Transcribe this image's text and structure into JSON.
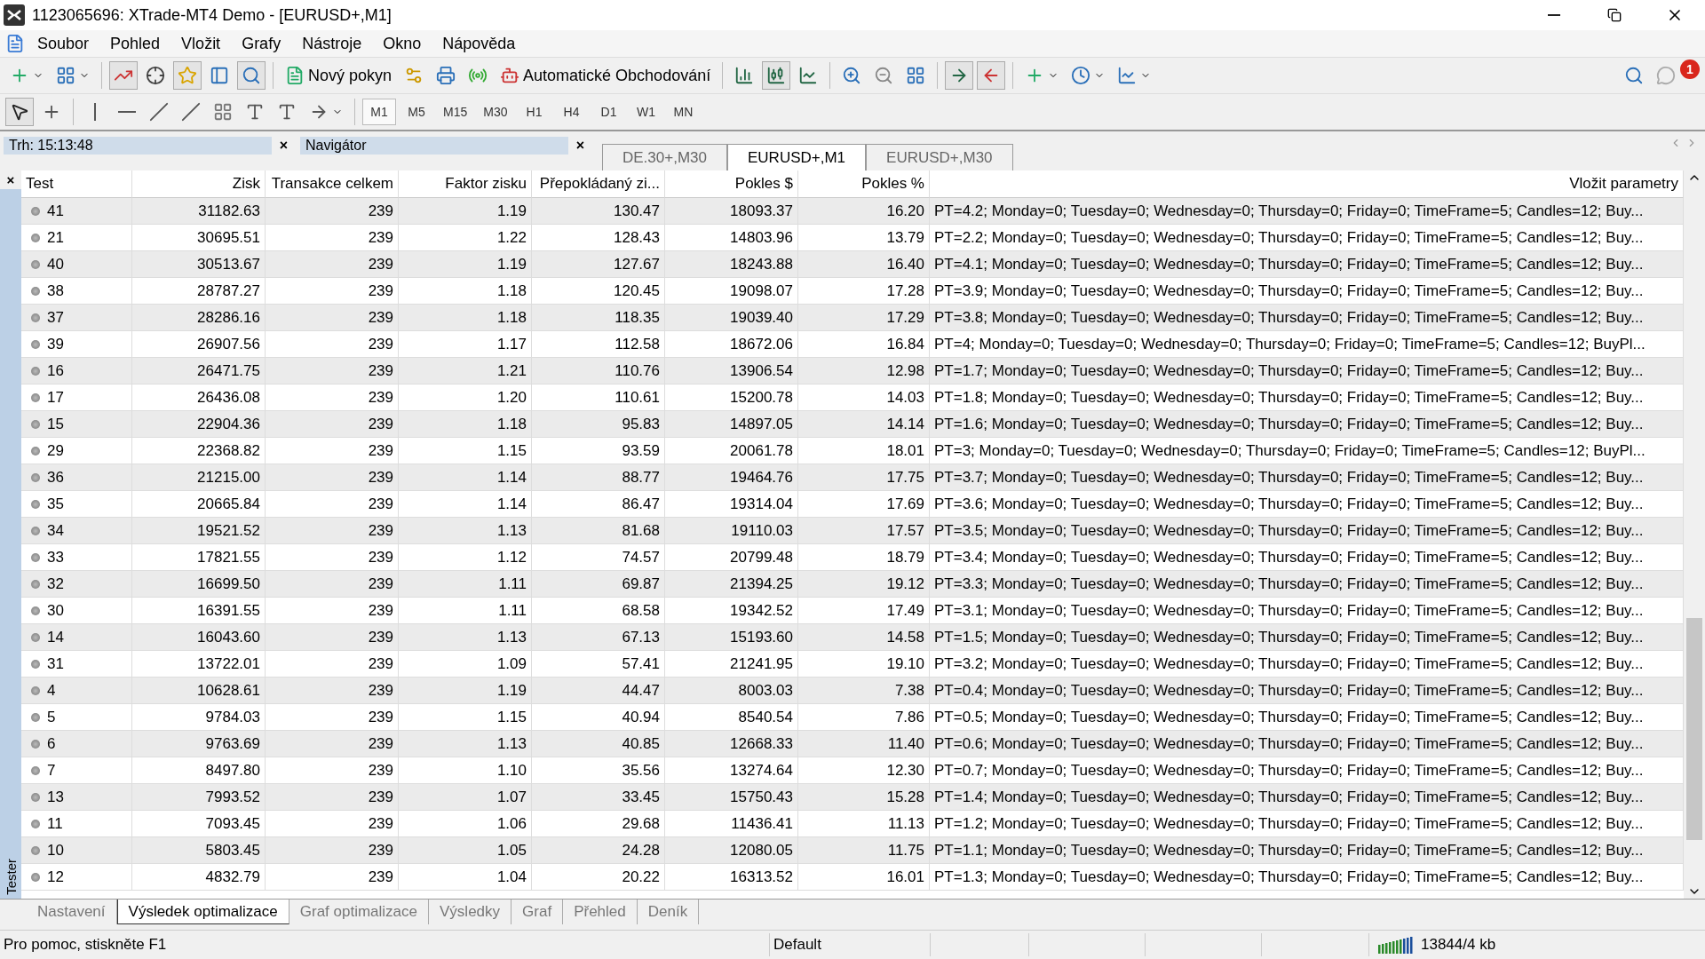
{
  "window": {
    "title": "1123065696: XTrade-MT4 Demo - [EURUSD+,M1]"
  },
  "menu": [
    "Soubor",
    "Pohled",
    "Vložit",
    "Grafy",
    "Nástroje",
    "Okno",
    "Nápověda"
  ],
  "toolbar": {
    "new_order": "Nový pokyn",
    "auto_trading": "Automatické Obchodování",
    "notification_count": "1"
  },
  "timeframes": [
    {
      "label": "M1",
      "selected": true
    },
    {
      "label": "M5",
      "selected": false
    },
    {
      "label": "M15",
      "selected": false
    },
    {
      "label": "M30",
      "selected": false
    },
    {
      "label": "H1",
      "selected": false
    },
    {
      "label": "H4",
      "selected": false
    },
    {
      "label": "D1",
      "selected": false
    },
    {
      "label": "W1",
      "selected": false
    },
    {
      "label": "MN",
      "selected": false
    }
  ],
  "panels": [
    {
      "title": "Trh: 15:13:48",
      "close": "×"
    },
    {
      "title": "Navigátor",
      "close": "×"
    }
  ],
  "chart_tabs": [
    {
      "label": "DE.30+,M30",
      "selected": false
    },
    {
      "label": "EURUSD+,M1",
      "selected": true
    },
    {
      "label": "EURUSD+,M30",
      "selected": false
    }
  ],
  "tester": {
    "label": "Tester",
    "close": "×"
  },
  "table": {
    "columns": [
      "Test",
      "Zisk",
      "Transakce celkem",
      "Faktor zisku",
      "Přepokládaný zi...",
      "Pokles $",
      "Pokles %",
      "Vložit parametry"
    ],
    "rows": [
      [
        "41",
        "31182.63",
        "239",
        "1.19",
        "130.47",
        "18093.37",
        "16.20",
        "PT=4.2; Monday=0; Tuesday=0; Wednesday=0; Thursday=0; Friday=0; TimeFrame=5; Candles=12; Buy..."
      ],
      [
        "21",
        "30695.51",
        "239",
        "1.22",
        "128.43",
        "14803.96",
        "13.79",
        "PT=2.2; Monday=0; Tuesday=0; Wednesday=0; Thursday=0; Friday=0; TimeFrame=5; Candles=12; Buy..."
      ],
      [
        "40",
        "30513.67",
        "239",
        "1.19",
        "127.67",
        "18243.88",
        "16.40",
        "PT=4.1; Monday=0; Tuesday=0; Wednesday=0; Thursday=0; Friday=0; TimeFrame=5; Candles=12; Buy..."
      ],
      [
        "38",
        "28787.27",
        "239",
        "1.18",
        "120.45",
        "19098.07",
        "17.28",
        "PT=3.9; Monday=0; Tuesday=0; Wednesday=0; Thursday=0; Friday=0; TimeFrame=5; Candles=12; Buy..."
      ],
      [
        "37",
        "28286.16",
        "239",
        "1.18",
        "118.35",
        "19039.40",
        "17.29",
        "PT=3.8; Monday=0; Tuesday=0; Wednesday=0; Thursday=0; Friday=0; TimeFrame=5; Candles=12; Buy..."
      ],
      [
        "39",
        "26907.56",
        "239",
        "1.17",
        "112.58",
        "18672.06",
        "16.84",
        "PT=4; Monday=0; Tuesday=0; Wednesday=0; Thursday=0; Friday=0; TimeFrame=5; Candles=12; BuyPl..."
      ],
      [
        "16",
        "26471.75",
        "239",
        "1.21",
        "110.76",
        "13906.54",
        "12.98",
        "PT=1.7; Monday=0; Tuesday=0; Wednesday=0; Thursday=0; Friday=0; TimeFrame=5; Candles=12; Buy..."
      ],
      [
        "17",
        "26436.08",
        "239",
        "1.20",
        "110.61",
        "15200.78",
        "14.03",
        "PT=1.8; Monday=0; Tuesday=0; Wednesday=0; Thursday=0; Friday=0; TimeFrame=5; Candles=12; Buy..."
      ],
      [
        "15",
        "22904.36",
        "239",
        "1.18",
        "95.83",
        "14897.05",
        "14.14",
        "PT=1.6; Monday=0; Tuesday=0; Wednesday=0; Thursday=0; Friday=0; TimeFrame=5; Candles=12; Buy..."
      ],
      [
        "29",
        "22368.82",
        "239",
        "1.15",
        "93.59",
        "20061.78",
        "18.01",
        "PT=3; Monday=0; Tuesday=0; Wednesday=0; Thursday=0; Friday=0; TimeFrame=5; Candles=12; BuyPl..."
      ],
      [
        "36",
        "21215.00",
        "239",
        "1.14",
        "88.77",
        "19464.76",
        "17.75",
        "PT=3.7; Monday=0; Tuesday=0; Wednesday=0; Thursday=0; Friday=0; TimeFrame=5; Candles=12; Buy..."
      ],
      [
        "35",
        "20665.84",
        "239",
        "1.14",
        "86.47",
        "19314.04",
        "17.69",
        "PT=3.6; Monday=0; Tuesday=0; Wednesday=0; Thursday=0; Friday=0; TimeFrame=5; Candles=12; Buy..."
      ],
      [
        "34",
        "19521.52",
        "239",
        "1.13",
        "81.68",
        "19110.03",
        "17.57",
        "PT=3.5; Monday=0; Tuesday=0; Wednesday=0; Thursday=0; Friday=0; TimeFrame=5; Candles=12; Buy..."
      ],
      [
        "33",
        "17821.55",
        "239",
        "1.12",
        "74.57",
        "20799.48",
        "18.79",
        "PT=3.4; Monday=0; Tuesday=0; Wednesday=0; Thursday=0; Friday=0; TimeFrame=5; Candles=12; Buy..."
      ],
      [
        "32",
        "16699.50",
        "239",
        "1.11",
        "69.87",
        "21394.25",
        "19.12",
        "PT=3.3; Monday=0; Tuesday=0; Wednesday=0; Thursday=0; Friday=0; TimeFrame=5; Candles=12; Buy..."
      ],
      [
        "30",
        "16391.55",
        "239",
        "1.11",
        "68.58",
        "19342.52",
        "17.49",
        "PT=3.1; Monday=0; Tuesday=0; Wednesday=0; Thursday=0; Friday=0; TimeFrame=5; Candles=12; Buy..."
      ],
      [
        "14",
        "16043.60",
        "239",
        "1.13",
        "67.13",
        "15193.60",
        "14.58",
        "PT=1.5; Monday=0; Tuesday=0; Wednesday=0; Thursday=0; Friday=0; TimeFrame=5; Candles=12; Buy..."
      ],
      [
        "31",
        "13722.01",
        "239",
        "1.09",
        "57.41",
        "21241.95",
        "19.10",
        "PT=3.2; Monday=0; Tuesday=0; Wednesday=0; Thursday=0; Friday=0; TimeFrame=5; Candles=12; Buy..."
      ],
      [
        "4",
        "10628.61",
        "239",
        "1.19",
        "44.47",
        "8003.03",
        "7.38",
        "PT=0.4; Monday=0; Tuesday=0; Wednesday=0; Thursday=0; Friday=0; TimeFrame=5; Candles=12; Buy..."
      ],
      [
        "5",
        "9784.03",
        "239",
        "1.15",
        "40.94",
        "8540.54",
        "7.86",
        "PT=0.5; Monday=0; Tuesday=0; Wednesday=0; Thursday=0; Friday=0; TimeFrame=5; Candles=12; Buy..."
      ],
      [
        "6",
        "9763.69",
        "239",
        "1.13",
        "40.85",
        "12668.33",
        "11.40",
        "PT=0.6; Monday=0; Tuesday=0; Wednesday=0; Thursday=0; Friday=0; TimeFrame=5; Candles=12; Buy..."
      ],
      [
        "7",
        "8497.80",
        "239",
        "1.10",
        "35.56",
        "13274.64",
        "12.30",
        "PT=0.7; Monday=0; Tuesday=0; Wednesday=0; Thursday=0; Friday=0; TimeFrame=5; Candles=12; Buy..."
      ],
      [
        "13",
        "7993.52",
        "239",
        "1.07",
        "33.45",
        "15750.43",
        "15.28",
        "PT=1.4; Monday=0; Tuesday=0; Wednesday=0; Thursday=0; Friday=0; TimeFrame=5; Candles=12; Buy..."
      ],
      [
        "11",
        "7093.45",
        "239",
        "1.06",
        "29.68",
        "11436.41",
        "11.13",
        "PT=1.2; Monday=0; Tuesday=0; Wednesday=0; Thursday=0; Friday=0; TimeFrame=5; Candles=12; Buy..."
      ],
      [
        "10",
        "5803.45",
        "239",
        "1.05",
        "24.28",
        "12080.05",
        "11.75",
        "PT=1.1; Monday=0; Tuesday=0; Wednesday=0; Thursday=0; Friday=0; TimeFrame=5; Candles=12; Buy..."
      ],
      [
        "12",
        "4832.79",
        "239",
        "1.04",
        "20.22",
        "16313.52",
        "16.01",
        "PT=1.3; Monday=0; Tuesday=0; Wednesday=0; Thursday=0; Friday=0; TimeFrame=5; Candles=12; Buy..."
      ]
    ]
  },
  "bottom_tabs": [
    {
      "label": "Nastavení",
      "selected": false
    },
    {
      "label": "Výsledek optimalizace",
      "selected": true
    },
    {
      "label": "Graf optimalizace",
      "selected": false
    },
    {
      "label": "Výsledky",
      "selected": false
    },
    {
      "label": "Graf",
      "selected": false
    },
    {
      "label": "Přehled",
      "selected": false
    },
    {
      "label": "Deník",
      "selected": false
    }
  ],
  "status_bar": {
    "help": "Pro pomoc, stiskněte F1",
    "profile": "Default",
    "traffic": "13844/4 kb"
  }
}
